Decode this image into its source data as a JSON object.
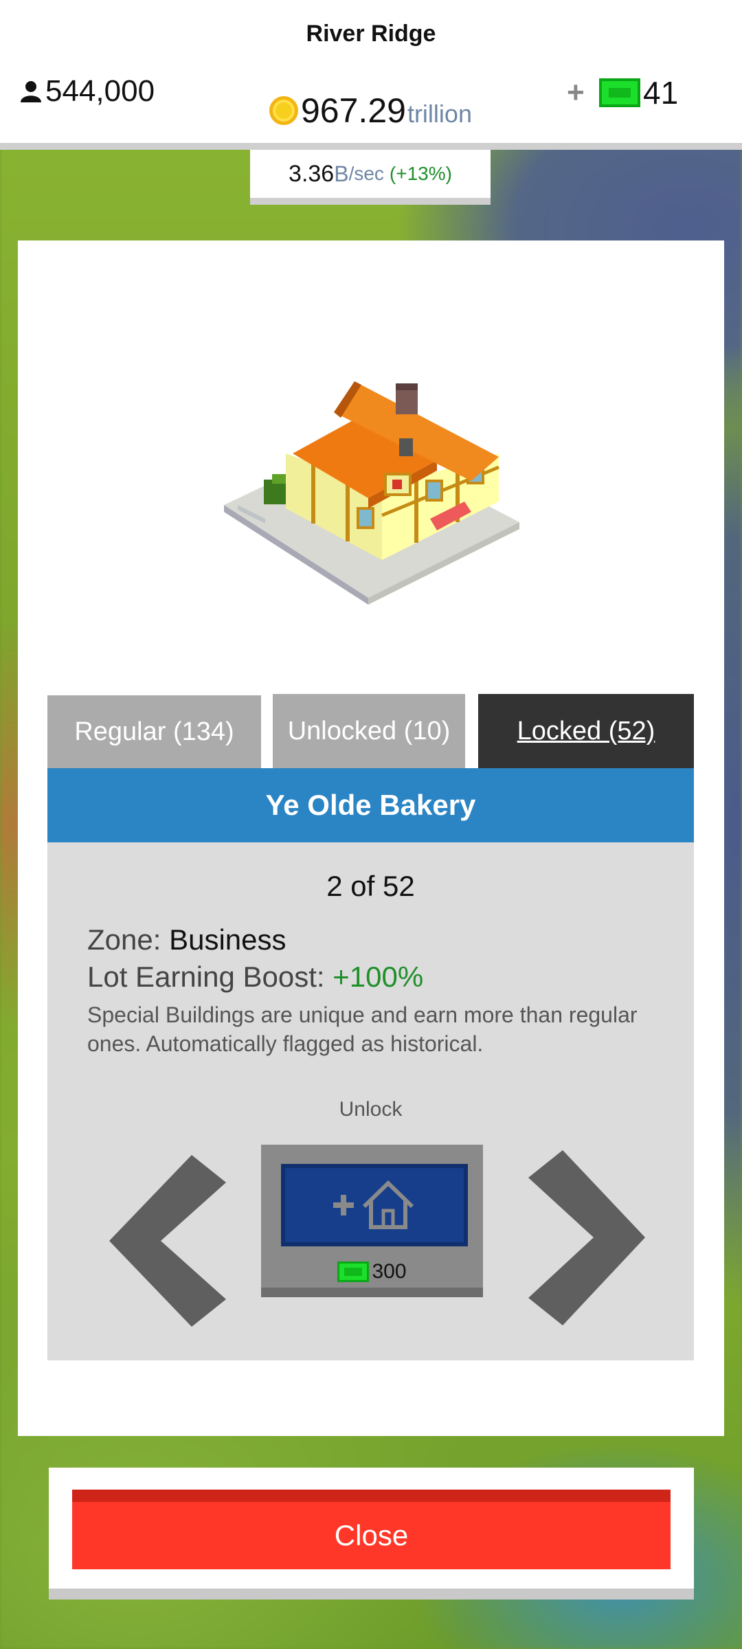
{
  "header": {
    "city_name": "River Ridge",
    "population": "544,000",
    "coins_value": "967.29",
    "coins_unit": "trillion",
    "add_cash_label": "+",
    "cash": "41",
    "rate_value": "3.36",
    "rate_unit": "B",
    "rate_per": "/sec",
    "rate_boost": "(+13%)"
  },
  "tabs": [
    {
      "label": "Regular (134)",
      "selected": false
    },
    {
      "label": "Unlocked (10)",
      "selected": false
    },
    {
      "label": "Locked (52)",
      "selected": true
    }
  ],
  "building": {
    "name": "Ye Olde Bakery",
    "counter": "2 of 52",
    "zone_label": "Zone:",
    "zone_value": "Business",
    "boost_label": "Lot Earning Boost:",
    "boost_value": "+100%",
    "description": "Special Buildings are unique and earn more than regular ones. Automatically flagged as historical."
  },
  "unlock": {
    "label": "Unlock",
    "cost": "300",
    "icon": "add-house-icon"
  },
  "close_label": "Close",
  "colors": {
    "accent_blue": "#2b85c4",
    "close_red": "#ff3728",
    "boost_green": "#1f8f2a",
    "locked_tab": "#333333",
    "tab_gray": "#ababab"
  }
}
